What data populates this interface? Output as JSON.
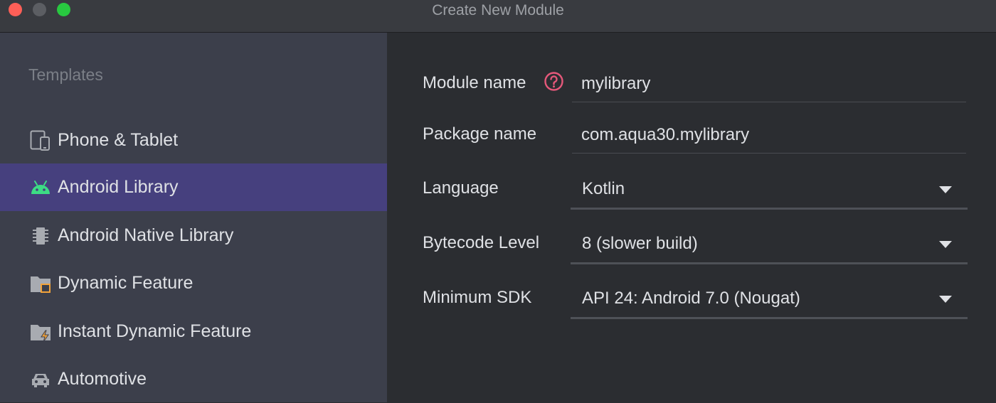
{
  "window": {
    "title": "Create New Module"
  },
  "sidebar": {
    "heading": "Templates",
    "items": [
      {
        "label": "Phone & Tablet",
        "icon": "phone-tablet-icon"
      },
      {
        "label": "Android Library",
        "icon": "android-icon",
        "selected": true
      },
      {
        "label": "Android Native Library",
        "icon": "native-chip-icon"
      },
      {
        "label": "Dynamic Feature",
        "icon": "folder-module-icon"
      },
      {
        "label": "Instant Dynamic Feature",
        "icon": "folder-lightning-icon"
      },
      {
        "label": "Automotive",
        "icon": "car-icon"
      }
    ]
  },
  "form": {
    "module_name": {
      "label": "Module name",
      "value": "mylibrary"
    },
    "package_name": {
      "label": "Package name",
      "value": "com.aqua30.mylibrary"
    },
    "language": {
      "label": "Language",
      "value": "Kotlin"
    },
    "bytecode_level": {
      "label": "Bytecode Level",
      "value": "8 (slower build)"
    },
    "minimum_sdk": {
      "label": "Minimum SDK",
      "value": "API 24: Android 7.0 (Nougat)"
    }
  },
  "colors": {
    "selection": "#46407e",
    "sidebar_bg": "#3c3f4b",
    "content_bg": "#2b2d31",
    "help": "#e5587a",
    "android_green": "#3ddc84",
    "accent_orange": "#f2a33a"
  }
}
